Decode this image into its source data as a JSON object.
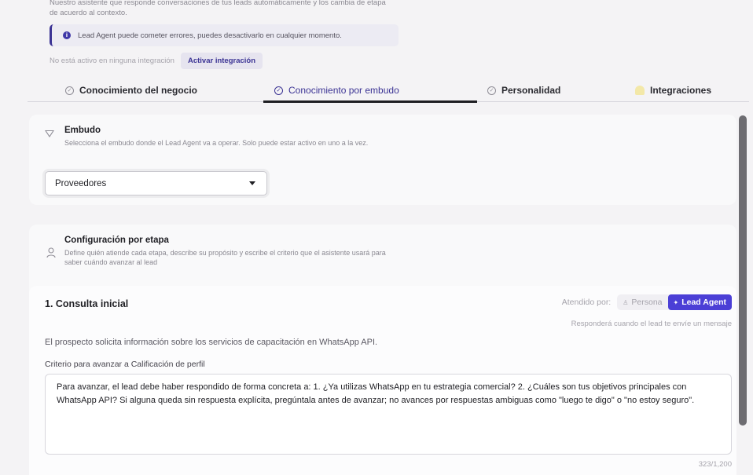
{
  "header": {
    "description": "Nuestro asistente que responde conversaciones de tus leads automáticamente y los cambia de etapa de acuerdo al contexto.",
    "alert_text": "Lead Agent puede cometer errores, puedes desactivarlo en cualquier momento.",
    "integration_status": "No está activo en ninguna integración",
    "activate_button": "Activar integración"
  },
  "tabs": [
    {
      "label": "Conocimiento del negocio",
      "icon": "check-circle-icon",
      "active": false
    },
    {
      "label": "Conocimiento por embudo",
      "icon": "check-circle-icon",
      "active": true
    },
    {
      "label": "Personalidad",
      "icon": "check-circle-icon",
      "active": false
    },
    {
      "label": "Integraciones",
      "icon": "bell-icon",
      "active": false
    }
  ],
  "funnel": {
    "title": "Embudo",
    "subtitle": "Selecciona el embudo donde el Lead Agent va a operar. Solo puede estar activo en uno a la vez.",
    "selected": "Proveedores",
    "icon": "funnel-icon"
  },
  "stage_config": {
    "title": "Configuración por etapa",
    "subtitle": "Define quién atiende cada etapa, describe su propósito y escribe el criterio que el asistente usará para saber cuándo avanzar al lead",
    "icon": "person-icon"
  },
  "stage": {
    "name": "1. Consulta inicial",
    "attended_label": "Atendido por:",
    "option_person": "Persona",
    "option_agent": "Lead Agent",
    "selected_option": "Lead Agent",
    "respond_note": "Responderá cuando el lead te envíe un mensaje",
    "description": "El prospecto solicita información sobre los servicios de capacitación en WhatsApp API.",
    "criteria_label": "Criterio para avanzar a Calificación de perfil",
    "criteria_text": "Para avanzar, el lead debe haber respondido de forma concreta a: 1. ¿Ya utilizas WhatsApp en tu estrategia comercial? 2. ¿Cuáles son tus objetivos principales con WhatsApp API? Si alguna queda sin respuesta explícita, pregúntala antes de avanzar; no avances por respuestas ambiguas como \"luego te digo\" o \"no estoy seguro\".",
    "char_count": "323/1,200"
  },
  "colors": {
    "accent": "#3b3394",
    "agent_button": "#4b3fd6",
    "background": "#f4f3f5"
  }
}
